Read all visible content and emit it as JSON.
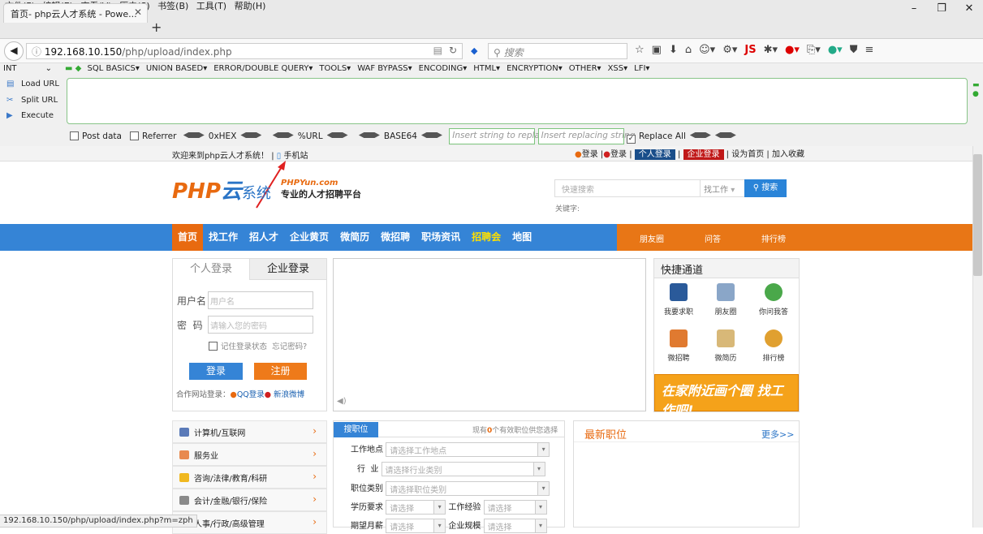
{
  "menubar": {
    "items": [
      "文件(F)",
      "编辑(E)",
      "查看(V)",
      "历史(S)",
      "书签(B)",
      "工具(T)",
      "帮助(H)"
    ]
  },
  "window": {
    "minimize": "–",
    "restore": "❐",
    "close": "✕"
  },
  "tab": {
    "title": "首页- php云人才系统 - Powe...",
    "close": "✕",
    "new": "+"
  },
  "address": {
    "host": "192.168.10.150",
    "path": "/php/upload/index.php",
    "search_placeholder": "搜索"
  },
  "hackbar": {
    "select": "INT",
    "menu": [
      "SQL BASICS▾",
      "UNION BASED▾",
      "ERROR/DOUBLE QUERY▾",
      "TOOLS▾",
      "WAF BYPASS▾",
      "ENCODING▾",
      "HTML▾",
      "ENCRYPTION▾",
      "OTHER▾",
      "XSS▾",
      "LFI▾"
    ],
    "load_url": "Load URL",
    "split_url": "Split URL",
    "execute": "Execute",
    "post_data": "Post data",
    "referrer": "Referrer",
    "hex": "0xHEX",
    "url": "%URL",
    "base64": "BASE64",
    "insert_placeholder": "Insert string to replace",
    "replacing_placeholder": "Insert replacing string",
    "replace_all": "Replace All"
  },
  "site": {
    "welcome": "欢迎来到php云人才系统！",
    "mobile": "手机站",
    "login1": "登录",
    "login2": "登录",
    "personal_login": "个人登录",
    "company_login": "企业登录",
    "set_home": "设为首页",
    "add_fav": "加入收藏",
    "logo_php": "PHP",
    "logo_yun": "云",
    "logo_sys": "系统",
    "slogan_en": "PHPYun.com",
    "slogan_cn": "专业的人才招聘平台",
    "search_placeholder": "快速搜索",
    "search_select": "找工作",
    "search_button": "搜索",
    "keyword_label": "关键字:",
    "nav": [
      "首页",
      "找工作",
      "招人才",
      "企业黄页",
      "微简历",
      "微招聘",
      "职场资讯",
      "招聘会",
      "地图"
    ],
    "nav_right": [
      "朋友圈",
      "问答",
      "排行榜"
    ],
    "login_tabs": [
      "个人登录",
      "企业登录"
    ],
    "user_label": "用户名",
    "user_placeholder": "用户名",
    "pass_label": "密  码",
    "pass_placeholder": "请输入您的密码",
    "remember": "记住登录状态",
    "forgot": "忘记密码?",
    "btn_login": "登录",
    "btn_register": "注册",
    "coop_label": "合作网站登录：",
    "qq": "QQ登录",
    "weibo": "新浪微博",
    "quick_title": "快捷通道",
    "quick_items": [
      "我要求职",
      "朋友圈",
      "你问我答",
      "微招聘",
      "微简历",
      "排行榜"
    ],
    "ad_text": "在家附近画个圈 找工作吧!",
    "categories": [
      "计算机/互联网",
      "服务业",
      "咨询/法律/教育/科研",
      "会计/金融/银行/保险",
      "人事/行政/高级管理"
    ],
    "job_tab": "搜职位",
    "job_count_pre": "现有",
    "job_count": "0",
    "job_count_post": "个有效职位供您选择",
    "f_location": "工作地点",
    "f_location_ph": "请选择工作地点",
    "f_industry": "行  业",
    "f_industry_ph": "请选择行业类别",
    "f_category": "职位类别",
    "f_category_ph": "请选择职位类别",
    "f_edu": "学历要求",
    "f_edu_ph": "请选择",
    "f_exp": "工作经验",
    "f_exp_ph": "请选择",
    "f_salary": "期望月薪",
    "f_salary_ph": "请选择",
    "f_size": "企业规模",
    "f_size_ph": "请选择",
    "new_jobs": "最新职位",
    "more": "更多>>"
  },
  "status": "192.168.10.150/php/upload/index.php?m=zph"
}
